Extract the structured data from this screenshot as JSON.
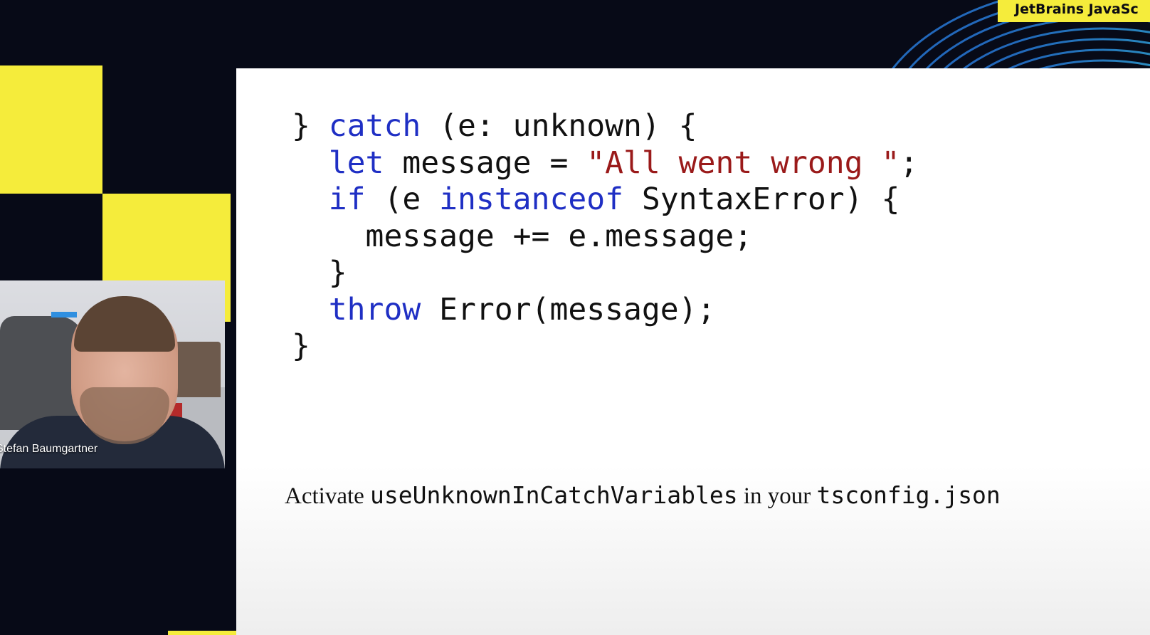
{
  "conference": {
    "badge_text": "JetBrains JavaSc"
  },
  "slide": {
    "code_lines": [
      [
        {
          "t": "} ",
          "c": "plain"
        },
        {
          "t": "catch",
          "c": "kw"
        },
        {
          "t": " (e: unknown) {",
          "c": "plain"
        }
      ],
      [
        {
          "t": "  ",
          "c": "plain"
        },
        {
          "t": "let",
          "c": "kw"
        },
        {
          "t": " message = ",
          "c": "plain"
        },
        {
          "t": "\"All went wrong \"",
          "c": "str"
        },
        {
          "t": ";",
          "c": "plain"
        }
      ],
      [
        {
          "t": "  ",
          "c": "plain"
        },
        {
          "t": "if",
          "c": "kw"
        },
        {
          "t": " (e ",
          "c": "plain"
        },
        {
          "t": "instanceof",
          "c": "kw"
        },
        {
          "t": " SyntaxError) {",
          "c": "plain"
        }
      ],
      [
        {
          "t": "    message += e.message;",
          "c": "plain"
        }
      ],
      [
        {
          "t": "  }",
          "c": "plain"
        }
      ],
      [
        {
          "t": "  ",
          "c": "plain"
        },
        {
          "t": "throw",
          "c": "kw"
        },
        {
          "t": " Error(message);",
          "c": "plain"
        }
      ],
      [
        {
          "t": "}",
          "c": "plain"
        }
      ]
    ],
    "caption": {
      "part1": "Activate ",
      "part2": "useUnknownInCatchVariables",
      "part3": " in your ",
      "part4": "tsconfig.json"
    }
  },
  "speaker": {
    "name": "Stefan Baumgartner"
  },
  "colors": {
    "accent_yellow": "#f5ec3b",
    "background": "#070a17",
    "keyword_blue": "#1f2fc4",
    "string_red": "#9a1a1a"
  }
}
